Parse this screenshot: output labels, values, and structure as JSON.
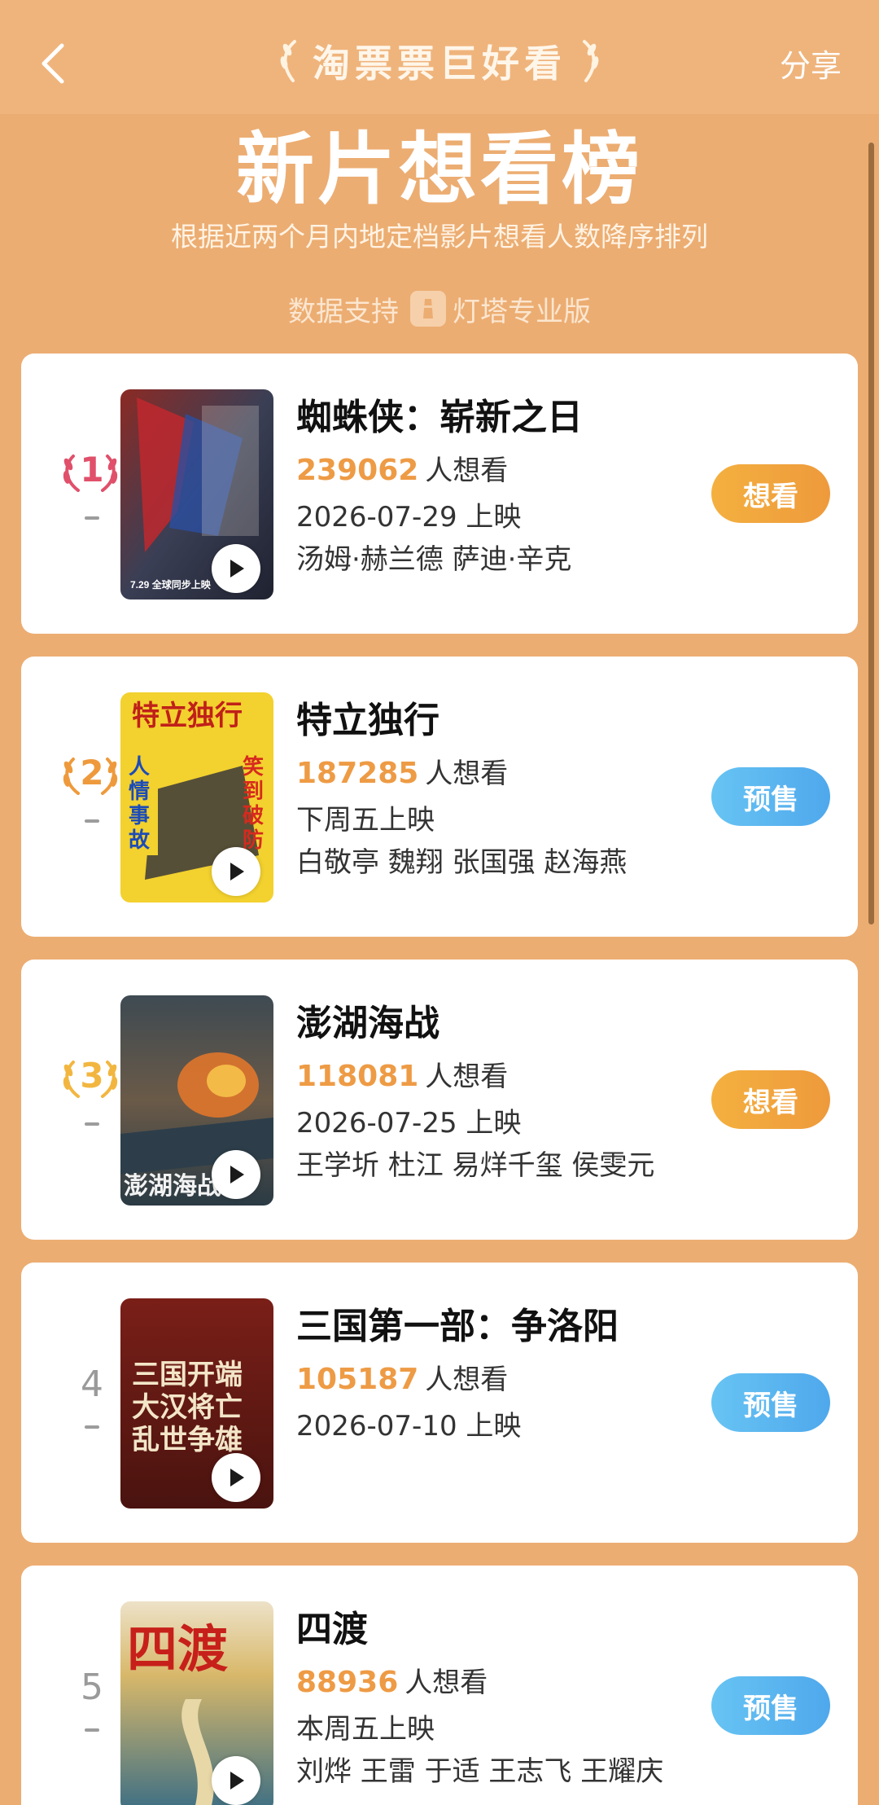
{
  "nav": {
    "brand": "淘票票巨好看",
    "share": "分享",
    "back_icon": "chevron-left-icon"
  },
  "header": {
    "title": "新片想看榜",
    "subtitle": "根据近两个月内地定档影片想看人数降序排列",
    "data_support_label": "数据支持",
    "data_provider": "灯塔专业版"
  },
  "colors": {
    "background": "#ECAD72",
    "count": "#EE9B45",
    "want_button": "#EF9F3D",
    "presale_button": "#5BB5EF",
    "rank1": "#E0506A",
    "rank2": "#EE9A3C",
    "rank3": "#F2B640"
  },
  "movies": [
    {
      "rank": "1",
      "title": "蜘蛛侠：崭新之日",
      "want_count": "239062",
      "want_suffix": "人想看",
      "release": "2026-07-29 上映",
      "cast": "汤姆·赫兰德 萨迪·辛克",
      "action": "想看",
      "poster_text": "7.29 全球同步上映"
    },
    {
      "rank": "2",
      "title": "特立独行",
      "want_count": "187285",
      "want_suffix": "人想看",
      "release": "下周五上映",
      "cast": "白敬亭 魏翔 张国强 赵海燕",
      "action": "预售",
      "poster_text": "特立独行"
    },
    {
      "rank": "3",
      "title": "澎湖海战",
      "want_count": "118081",
      "want_suffix": "人想看",
      "release": "2026-07-25 上映",
      "cast": "王学圻 杜江 易烊千玺 侯雯元",
      "action": "想看",
      "poster_text": "澎湖海战"
    },
    {
      "rank": "4",
      "title": "三国第一部：争洛阳",
      "want_count": "105187",
      "want_suffix": "人想看",
      "release": "2026-07-10 上映",
      "cast": "",
      "action": "预售",
      "poster_text": "三国开端 大汉将亡 乱世争雄"
    },
    {
      "rank": "5",
      "title": "四渡",
      "want_count": "88936",
      "want_suffix": "人想看",
      "release": "本周五上映",
      "cast": "刘烨 王雷 于适 王志飞 王耀庆",
      "action": "预售",
      "poster_text": "四渡"
    }
  ]
}
